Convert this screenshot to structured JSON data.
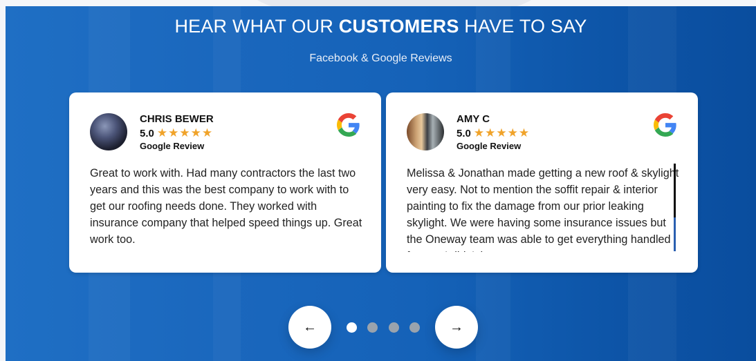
{
  "header": {
    "title_prefix": "HEAR WHAT OUR ",
    "title_emphasis": "CUSTOMERS",
    "title_suffix": " HAVE TO SAY",
    "subtitle": "Facebook & Google Reviews"
  },
  "reviews": [
    {
      "name": "CHRIS BEWER",
      "rating": "5.0",
      "stars": "★★★★★",
      "source": "Google Review",
      "text": "Great to work with. Had many contractors the last two years and this was the best company to work with to get our roofing needs done. They worked with insurance company that helped speed things up. Great work too."
    },
    {
      "name": "AMY C",
      "rating": "5.0",
      "stars": "★★★★★",
      "source": "Google Review",
      "text": "Melissa & Jonathan made getting a new roof & skylight very easy. Not to mention the soffit repair & interior painting to fix the damage from our prior leaking skylight. We were having some insurance issues but the Oneway team was able to get everything handled for me. I didn't have to"
    }
  ],
  "carousel": {
    "prev_icon": "arrow-left-icon",
    "next_icon": "arrow-right-icon",
    "prev_glyph": "←",
    "next_glyph": "→",
    "dot_count": 4,
    "active_dot": 1
  },
  "colors": {
    "panel_blue": "#1a67bd",
    "star": "#f0a32a",
    "google_blue": "#4285F4",
    "google_red": "#EA4335",
    "google_yellow": "#FBBC05",
    "google_green": "#34A853"
  }
}
